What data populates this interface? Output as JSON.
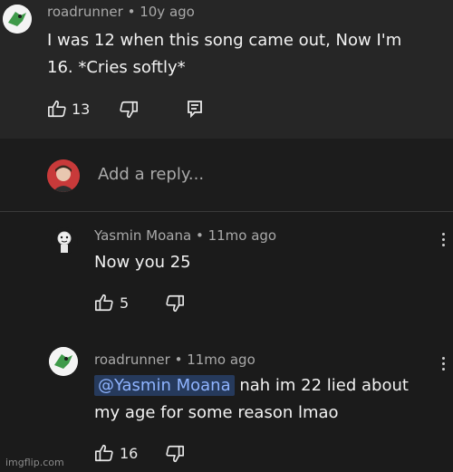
{
  "top_comment": {
    "author": "roadrunner",
    "time": "10y ago",
    "text_line1": "I was 12 when this song came out, Now I'm",
    "text_line2": "16. *Cries softly*",
    "likes": "13"
  },
  "reply_input": {
    "placeholder": "Add a reply..."
  },
  "replies": [
    {
      "author": "Yasmin Moana",
      "time": "11mo ago",
      "text": "Now you 25",
      "likes": "5"
    },
    {
      "author": "roadrunner",
      "time": "11mo ago",
      "mention": "@Yasmin Moana",
      "text_line1": "nah im 22 lied about",
      "text_line2": "my age for some reason lmao",
      "likes": "16"
    }
  ],
  "watermark": "imgflip.com",
  "colors": {
    "background": "#1b1b1b",
    "top_comment_bg": "#262626",
    "mention_bg": "#263a5c",
    "mention_text": "#8fb4ff"
  },
  "icons": [
    "thumbs-up-icon",
    "thumbs-down-icon",
    "reply-icon",
    "more-options-icon"
  ]
}
